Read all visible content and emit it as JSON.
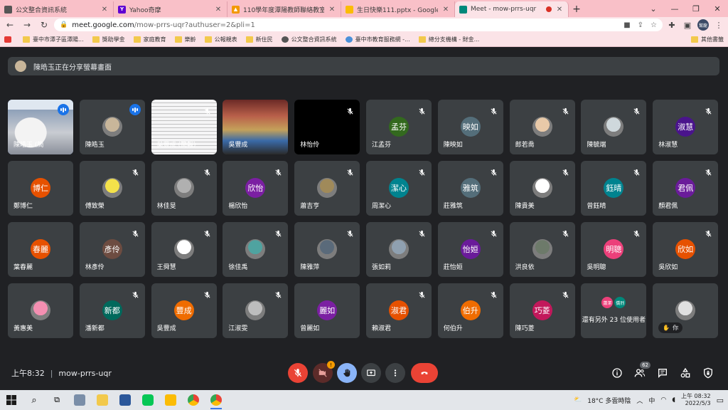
{
  "browser": {
    "tabs": [
      {
        "label": "公文整合資訊系統",
        "fav_color": "#555555",
        "fav_glyph": ""
      },
      {
        "label": "Yahoo奇摩",
        "fav_color": "#6001d2",
        "fav_glyph": "Y"
      },
      {
        "label": "110學年度潭陽教師聯絡教室",
        "fav_color": "#f29900",
        "fav_glyph": "▲"
      },
      {
        "label": "生日快樂111.pptx - Google 簡報",
        "fav_color": "#fbbc04",
        "fav_glyph": ""
      },
      {
        "label": "Meet - mow-prrs-uqr",
        "fav_color": "#00897b",
        "fav_glyph": ""
      }
    ],
    "address": {
      "host": "meet.google.com",
      "path": "/mow-prrs-uqr?authuser=2&pli=1"
    },
    "profile_initials": "幫龍",
    "bookmarks": [
      {
        "label": "",
        "icon": "yt"
      },
      {
        "label": "臺中市潭子區潭陽...",
        "icon": "folder"
      },
      {
        "label": "獎助學金",
        "icon": "folder"
      },
      {
        "label": "家庭教育",
        "icon": "folder"
      },
      {
        "label": "樂齡",
        "icon": "folder"
      },
      {
        "label": "公報親表",
        "icon": "folder"
      },
      {
        "label": "新住民",
        "icon": "folder"
      },
      {
        "label": "公文整合資訊系統",
        "icon": "globe"
      },
      {
        "label": "臺中市教育服務網 -...",
        "icon": "g"
      },
      {
        "label": "總分支機構 - 財金...",
        "icon": "folder"
      }
    ],
    "other_bookmarks": "其他書籤"
  },
  "meet": {
    "banner_text": "陳皓玉正在分享螢幕畫面",
    "tiles": [
      {
        "name": "陳皓玉 (簡",
        "type": "screen",
        "speaking": true,
        "selected": true
      },
      {
        "name": "陳皓玉",
        "type": "photo",
        "color": "#c8b69a",
        "speaking": true
      },
      {
        "name": "吳豐成 (簡報)",
        "type": "doc",
        "muted": true
      },
      {
        "name": "吳豐成",
        "type": "video",
        "muted": false
      },
      {
        "name": "林怡伶",
        "type": "black",
        "muted": true
      },
      {
        "name": "江孟芬",
        "type": "letter",
        "letter": "孟芬",
        "color": "#33691e",
        "muted": true
      },
      {
        "name": "陳映如",
        "type": "letter",
        "letter": "映如",
        "color": "#546e7a",
        "muted": true
      },
      {
        "name": "郎若喬",
        "type": "photo",
        "color": "#e8c9a8",
        "muted": true
      },
      {
        "name": "陳毓端",
        "type": "photo",
        "color": "#cfd8dc",
        "muted": true
      },
      {
        "name": "林淑慧",
        "type": "letter",
        "letter": "淑慧",
        "color": "#4a148c",
        "muted": true
      },
      {
        "name": "鄭博仁",
        "type": "letter",
        "letter": "博仁",
        "color": "#e65100",
        "muted": false
      },
      {
        "name": "傅致榮",
        "type": "photo",
        "color": "#f4e24a",
        "muted": true
      },
      {
        "name": "林佳旻",
        "type": "photo",
        "color": "#b0b0b0",
        "muted": true
      },
      {
        "name": "楊欣怡",
        "type": "letter",
        "letter": "欣怡",
        "color": "#7b1fa2",
        "muted": true
      },
      {
        "name": "蕭吉亨",
        "type": "photo",
        "color": "#a08a5a",
        "muted": true
      },
      {
        "name": "周潔心",
        "type": "letter",
        "letter": "潔心",
        "color": "#00838f",
        "muted": true
      },
      {
        "name": "莊雅筑",
        "type": "letter",
        "letter": "雅筑",
        "color": "#546e7a",
        "muted": true
      },
      {
        "name": "陳貴美",
        "type": "photo",
        "color": "#ffffff",
        "muted": true
      },
      {
        "name": "曾鈺晴",
        "type": "letter",
        "letter": "鈺晴",
        "color": "#00838f",
        "muted": true
      },
      {
        "name": "顏君佩",
        "type": "letter",
        "letter": "君佩",
        "color": "#6a1b9a",
        "muted": true
      },
      {
        "name": "葉春麗",
        "type": "letter",
        "letter": "春麗",
        "color": "#e65100",
        "muted": false
      },
      {
        "name": "林彥伶",
        "type": "letter",
        "letter": "彥伶",
        "color": "#6d4c41",
        "muted": true
      },
      {
        "name": "王舜慧",
        "type": "photo",
        "color": "#ffffff",
        "muted": true
      },
      {
        "name": "徐佳禹",
        "type": "photo",
        "color": "#4fa3a0",
        "muted": true
      },
      {
        "name": "陳雅萍",
        "type": "photo",
        "color": "#5a6a7a",
        "muted": true
      },
      {
        "name": "張如莉",
        "type": "photo",
        "color": "#8fa0b0",
        "muted": true
      },
      {
        "name": "莊怡姮",
        "type": "letter",
        "letter": "怡姮",
        "color": "#6a1b9a",
        "muted": true
      },
      {
        "name": "洪良依",
        "type": "photo",
        "color": "#6d7a6a",
        "muted": true
      },
      {
        "name": "吳明聰",
        "type": "letter",
        "letter": "明聰",
        "color": "#ec407a",
        "muted": true
      },
      {
        "name": "吳欣如",
        "type": "letter",
        "letter": "欣如",
        "color": "#e65100",
        "muted": true
      },
      {
        "name": "黃惠美",
        "type": "photo",
        "color": "#f48fb1",
        "muted": false
      },
      {
        "name": "潘新都",
        "type": "letter",
        "letter": "新都",
        "color": "#00695c",
        "muted": true
      },
      {
        "name": "吳豐成",
        "type": "letter",
        "letter": "豐成",
        "color": "#ef6c00",
        "muted": true
      },
      {
        "name": "江淑雯",
        "type": "photo",
        "color": "#bdbdbd",
        "muted": true
      },
      {
        "name": "曾麗如",
        "type": "letter",
        "letter": "麗如",
        "color": "#7b1fa2",
        "muted": false
      },
      {
        "name": "賴淑君",
        "type": "letter",
        "letter": "淑君",
        "color": "#e65100",
        "muted": true
      },
      {
        "name": "何伯升",
        "type": "letter",
        "letter": "伯升",
        "color": "#ef6c00",
        "muted": true
      },
      {
        "name": "陳巧菱",
        "type": "letter",
        "letter": "巧菱",
        "color": "#c2185b",
        "muted": true
      },
      {
        "name": "還有另外 23 位使用者",
        "type": "more",
        "pair": [
          {
            "t": "蕭潔",
            "c": "#ec407a"
          },
          {
            "t": "僑烈",
            "c": "#00897b"
          }
        ]
      },
      {
        "name": "你",
        "type": "self",
        "color": "#e0e0e0"
      }
    ]
  },
  "bottombar": {
    "time": "上午8:32",
    "meeting_code": "mow-prrs-uqr",
    "people_count": "62",
    "camera_alert": "!"
  },
  "taskbar": {
    "weather": "18°C 多雲時陰",
    "lang": "中",
    "time": "上午 08:32",
    "date": "2022/5/3"
  }
}
